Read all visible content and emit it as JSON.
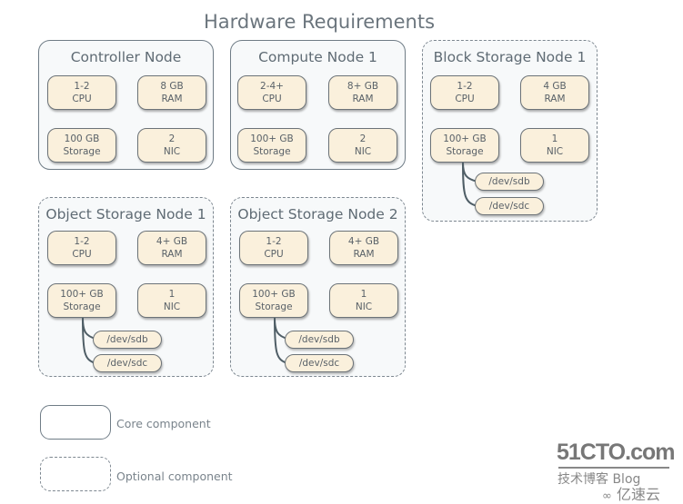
{
  "title": "Hardware Requirements",
  "nodes": {
    "controller": {
      "title": "Controller Node",
      "type": "core",
      "cpu": [
        "1-2",
        "CPU"
      ],
      "ram": [
        "8 GB",
        "RAM"
      ],
      "storage": [
        "100 GB",
        "Storage"
      ],
      "nic": [
        "2",
        "NIC"
      ]
    },
    "compute1": {
      "title": "Compute Node 1",
      "type": "core",
      "cpu": [
        "2-4+",
        "CPU"
      ],
      "ram": [
        "8+ GB",
        "RAM"
      ],
      "storage": [
        "100+ GB",
        "Storage"
      ],
      "nic": [
        "2",
        "NIC"
      ]
    },
    "block1": {
      "title": "Block Storage Node 1",
      "type": "optional",
      "cpu": [
        "1-2",
        "CPU"
      ],
      "ram": [
        "4 GB",
        "RAM"
      ],
      "storage": [
        "100+ GB",
        "Storage"
      ],
      "nic": [
        "1",
        "NIC"
      ],
      "devices": [
        "/dev/sdb",
        "/dev/sdc"
      ]
    },
    "object1": {
      "title": "Object Storage Node 1",
      "type": "optional",
      "cpu": [
        "1-2",
        "CPU"
      ],
      "ram": [
        "4+ GB",
        "RAM"
      ],
      "storage": [
        "100+ GB",
        "Storage"
      ],
      "nic": [
        "1",
        "NIC"
      ],
      "devices": [
        "/dev/sdb",
        "/dev/sdc"
      ]
    },
    "object2": {
      "title": "Object Storage Node 2",
      "type": "optional",
      "cpu": [
        "1-2",
        "CPU"
      ],
      "ram": [
        "4+ GB",
        "RAM"
      ],
      "storage": [
        "100+ GB",
        "Storage"
      ],
      "nic": [
        "1",
        "NIC"
      ],
      "devices": [
        "/dev/sdb",
        "/dev/sdc"
      ]
    }
  },
  "legend": {
    "core": "Core component",
    "optional": "Optional component"
  },
  "watermark": {
    "brand": "51CTO.com",
    "sub": "技术博客  Blog",
    "partner": "亿速云"
  }
}
